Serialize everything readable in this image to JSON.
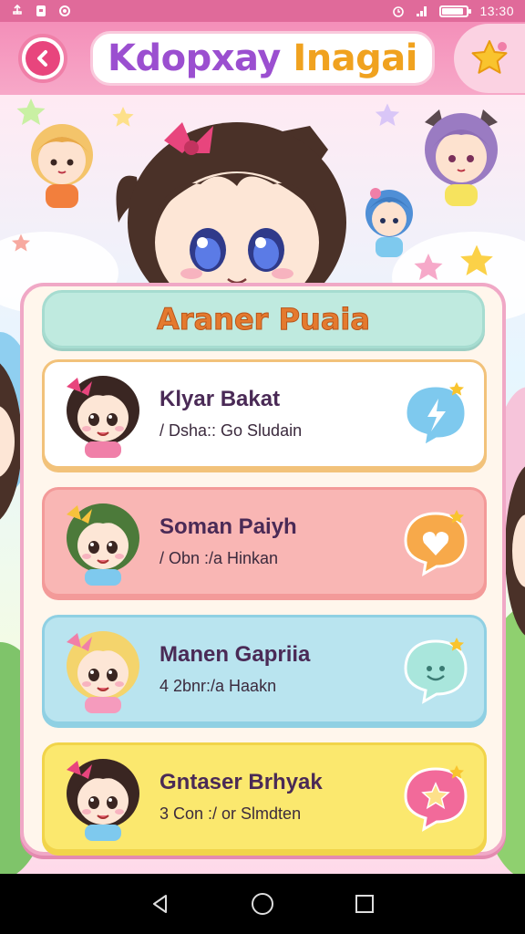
{
  "status_bar": {
    "time": "13:30",
    "battery_level": 0.8,
    "icons": [
      "usb-icon",
      "notification-icon",
      "sync-icon",
      "alarm-icon",
      "signal-icon",
      "battery-icon"
    ]
  },
  "header": {
    "title_part1": "Kdopxay",
    "title_part2": "Inagai",
    "back_icon": "back-arrow-icon",
    "star_icon": "star-icon"
  },
  "panel": {
    "title": "Araner Puaia",
    "cards": [
      {
        "name": "Klyar Bakat",
        "subtitle": "/ Dsha:: Go Sludain",
        "bg": "#ffffff",
        "border": "#f2c27a",
        "chat_color": "#7ec9ee",
        "chat_icon": "lightning-chat-icon",
        "hair": "#3a2622",
        "bow": "#e8457d",
        "shirt": "#f07fa8"
      },
      {
        "name": "Soman Paiyh",
        "subtitle": "/ Obn :/a Hinkan",
        "bg": "#f9b6b4",
        "border": "#f39a99",
        "chat_color": "#f7a94a",
        "chat_icon": "heart-chat-icon",
        "hair": "#4c7a3a",
        "bow": "#f6c23c",
        "shirt": "#7ec9ee"
      },
      {
        "name": "Manen Gapriia",
        "subtitle": "4 2bnr:/a Haakn",
        "bg": "#b9e4ef",
        "border": "#8fd0e3",
        "chat_color": "#a9e6dc",
        "chat_icon": "smile-chat-icon",
        "hair": "#f4d46c",
        "bow": "#f07fa8",
        "shirt": "#f59bbd"
      },
      {
        "name": "Gntaser Brhyak",
        "subtitle": "3 Con :/ or Slmdten",
        "bg": "#fbe86e",
        "border": "#f1d44a",
        "chat_color": "#f26a9a",
        "chat_icon": "star-chat-icon",
        "hair": "#3a2622",
        "bow": "#e8457d",
        "shirt": "#7ec9ee"
      }
    ]
  },
  "nav": {
    "back_icon": "nav-back-icon",
    "home_icon": "nav-home-icon",
    "recents_icon": "nav-recents-icon"
  }
}
